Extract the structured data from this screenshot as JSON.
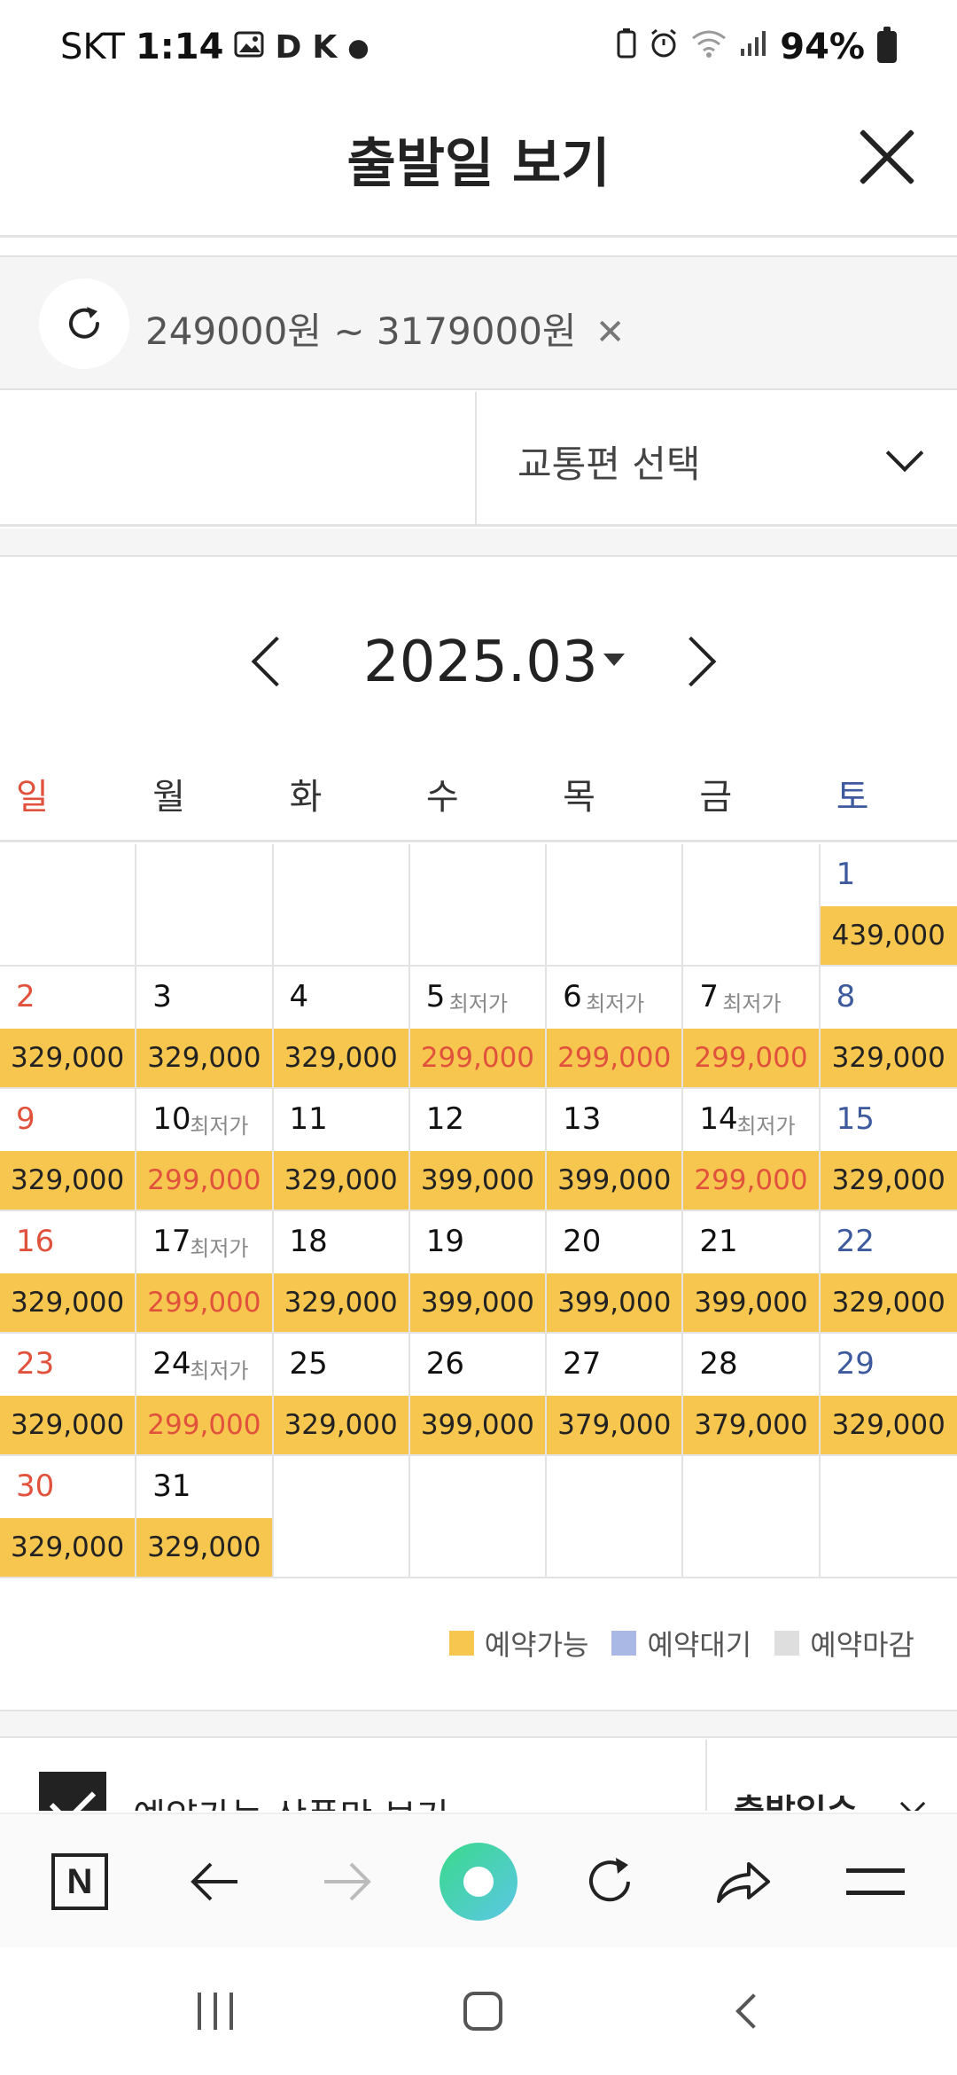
{
  "status_bar": {
    "carrier": "SKT",
    "time": "1:14",
    "battery": "94%",
    "left_icons": [
      "image-icon",
      "d-icon",
      "app-notification-icon",
      "dot-icon"
    ],
    "right_icons": [
      "battery-saver-icon",
      "alarm-icon",
      "wifi-icon",
      "signal-icon",
      "battery-icon"
    ]
  },
  "header": {
    "title": "출발일 보기"
  },
  "filter": {
    "price_range": "249000원 ~ 3179000원",
    "remove_symbol": "✕"
  },
  "transport": {
    "label": "교통편 선택"
  },
  "calendar": {
    "month": "2025.03",
    "weekdays": [
      "일",
      "월",
      "화",
      "수",
      "목",
      "금",
      "토"
    ],
    "lowest_label": "최저가",
    "colors": {
      "available": "#f6c64e",
      "waiting": "#aab8e6",
      "closed": "#dedede",
      "sunday": "#e1523d",
      "saturday": "#3d5a9e",
      "lowest_price": "#e1523d"
    },
    "weeks": [
      [
        null,
        null,
        null,
        null,
        null,
        null,
        {
          "day": "1",
          "price": "439,000",
          "lowest": false
        }
      ],
      [
        {
          "day": "2",
          "price": "329,000",
          "lowest": false
        },
        {
          "day": "3",
          "price": "329,000",
          "lowest": false
        },
        {
          "day": "4",
          "price": "329,000",
          "lowest": false
        },
        {
          "day": "5",
          "price": "299,000",
          "lowest": true
        },
        {
          "day": "6",
          "price": "299,000",
          "lowest": true
        },
        {
          "day": "7",
          "price": "299,000",
          "lowest": true
        },
        {
          "day": "8",
          "price": "329,000",
          "lowest": false
        }
      ],
      [
        {
          "day": "9",
          "price": "329,000",
          "lowest": false
        },
        {
          "day": "10",
          "price": "299,000",
          "lowest": true
        },
        {
          "day": "11",
          "price": "329,000",
          "lowest": false
        },
        {
          "day": "12",
          "price": "399,000",
          "lowest": false
        },
        {
          "day": "13",
          "price": "399,000",
          "lowest": false
        },
        {
          "day": "14",
          "price": "299,000",
          "lowest": true
        },
        {
          "day": "15",
          "price": "329,000",
          "lowest": false
        }
      ],
      [
        {
          "day": "16",
          "price": "329,000",
          "lowest": false
        },
        {
          "day": "17",
          "price": "299,000",
          "lowest": true
        },
        {
          "day": "18",
          "price": "329,000",
          "lowest": false
        },
        {
          "day": "19",
          "price": "399,000",
          "lowest": false
        },
        {
          "day": "20",
          "price": "399,000",
          "lowest": false
        },
        {
          "day": "21",
          "price": "399,000",
          "lowest": false
        },
        {
          "day": "22",
          "price": "329,000",
          "lowest": false
        }
      ],
      [
        {
          "day": "23",
          "price": "329,000",
          "lowest": false
        },
        {
          "day": "24",
          "price": "299,000",
          "lowest": true
        },
        {
          "day": "25",
          "price": "329,000",
          "lowest": false
        },
        {
          "day": "26",
          "price": "399,000",
          "lowest": false
        },
        {
          "day": "27",
          "price": "379,000",
          "lowest": false
        },
        {
          "day": "28",
          "price": "379,000",
          "lowest": false
        },
        {
          "day": "29",
          "price": "329,000",
          "lowest": false
        }
      ],
      [
        {
          "day": "30",
          "price": "329,000",
          "lowest": false
        },
        {
          "day": "31",
          "price": "329,000",
          "lowest": false
        },
        null,
        null,
        null,
        null,
        null
      ]
    ]
  },
  "legend": [
    {
      "label": "예약가능",
      "color": "#f6c64e"
    },
    {
      "label": "예약대기",
      "color": "#aab8e6"
    },
    {
      "label": "예약마감",
      "color": "#dedede"
    }
  ],
  "options": {
    "available_only_label": "예약가능 상품만 보기",
    "departure_days_label": "출발일수"
  },
  "browser_bar": {
    "buttons": [
      "naver-n-icon",
      "back-arrow-icon",
      "forward-arrow-icon",
      "home-dot-icon",
      "reload-icon",
      "share-icon",
      "menu-icon"
    ]
  }
}
